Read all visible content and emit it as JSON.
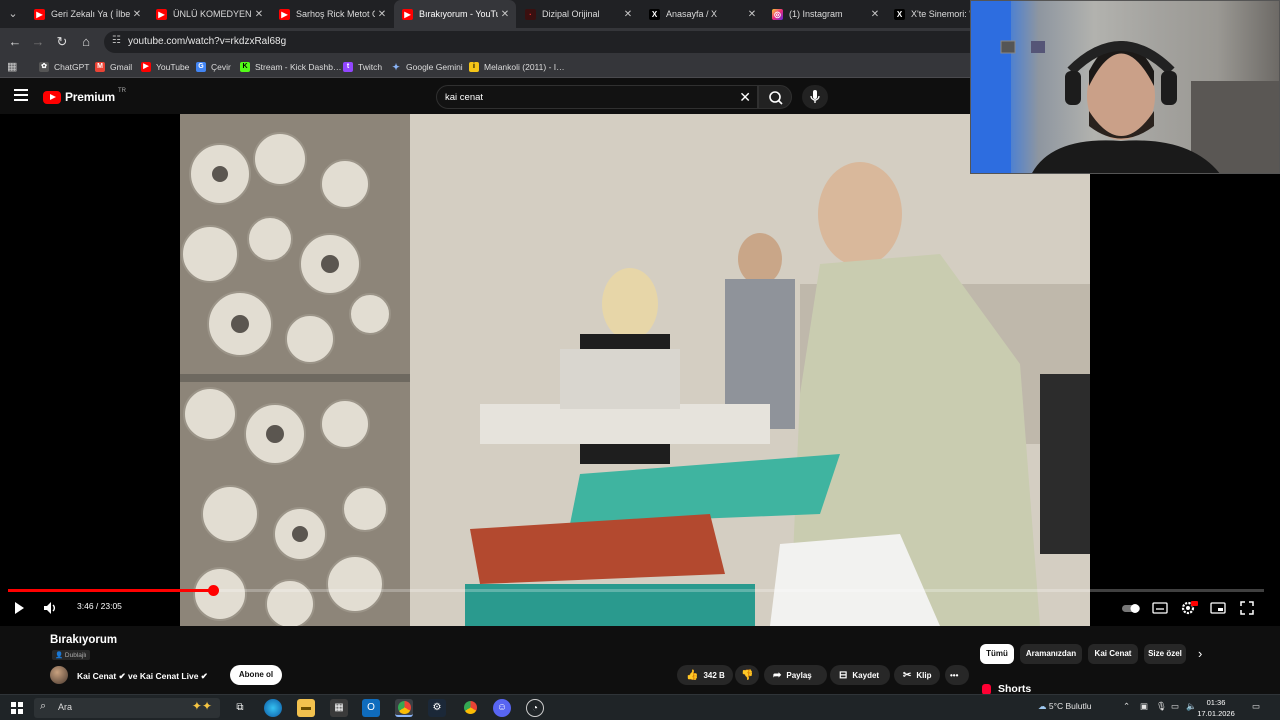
{
  "browser": {
    "tabs": [
      {
        "title": "Geri Zekalı Ya ( İlber Ortaylı…",
        "favicon": "youtube-favicon",
        "active": false
      },
      {
        "title": "ÜNLÜ KOMEDYENLERİN",
        "favicon": "youtube-favicon",
        "active": false
      },
      {
        "title": "Sarhoş Rick Metot Oyuncu",
        "favicon": "youtube-favicon",
        "active": false
      },
      {
        "title": "Bırakıyorum - YouTube",
        "favicon": "youtube-favicon",
        "active": true
      },
      {
        "title": "Dizipal Orijinal",
        "favicon": "dizipal-favicon",
        "active": false
      },
      {
        "title": "Anasayfa / X",
        "favicon": "x-favicon",
        "active": false
      },
      {
        "title": "(1) Instagram",
        "favicon": "instagram-favicon",
        "active": false
      },
      {
        "title": "X'te Sinemori: \"Tom",
        "favicon": "x-favicon",
        "active": false
      }
    ],
    "url": "youtube.com/watch?v=rkdzxRal68g",
    "bookmarks": [
      {
        "label": "ChatGPT",
        "icon": "chatgpt-icon"
      },
      {
        "label": "Gmail",
        "icon": "gmail-icon"
      },
      {
        "label": "YouTube",
        "icon": "youtube-icon"
      },
      {
        "label": "Çevir",
        "icon": "translate-icon"
      },
      {
        "label": "Stream - Kick Dashb…",
        "icon": "kick-icon"
      },
      {
        "label": "Twitch",
        "icon": "twitch-icon"
      },
      {
        "label": "Google Gemini",
        "icon": "gemini-icon"
      },
      {
        "label": "Melankoli (2011) - I…",
        "icon": "imdb-icon"
      }
    ]
  },
  "youtube": {
    "logo_text": "Premium",
    "logo_country": "TR",
    "search_query": "kai cenat",
    "player": {
      "time_current": "3:46",
      "time_total": "23:05",
      "time_display": "3:46 / 23:05",
      "progress_fraction": 0.163,
      "accent": "#ff0000"
    },
    "video": {
      "title": "Bırakıyorum",
      "dubbed_label": "Dublajlı",
      "channel_text": "Kai Cenat ✔ ve Kai Cenat Live ✔",
      "subscribe_label": "Abone ol",
      "likes": "342 B",
      "share_label": "Paylaş",
      "save_label": "Kaydet",
      "clip_label": "Klip",
      "more_label": "•••"
    },
    "chips": [
      {
        "label": "Tümü",
        "selected": true
      },
      {
        "label": "Aramanızdan",
        "selected": false
      },
      {
        "label": "Kai Cenat",
        "selected": false
      },
      {
        "label": "Size özel",
        "selected": false
      }
    ],
    "shorts_label": "Shorts"
  },
  "taskbar": {
    "search_label": "Ara",
    "weather": "5°C  Bulutlu",
    "time": "01:36",
    "date": "17.01.2026",
    "apps": [
      "task-view-icon",
      "edge-icon",
      "file-explorer-icon",
      "store-icon",
      "outlook-icon",
      "chrome-icon",
      "steam-icon",
      "chrome-alt-icon",
      "discord-icon",
      "obs-icon"
    ]
  }
}
